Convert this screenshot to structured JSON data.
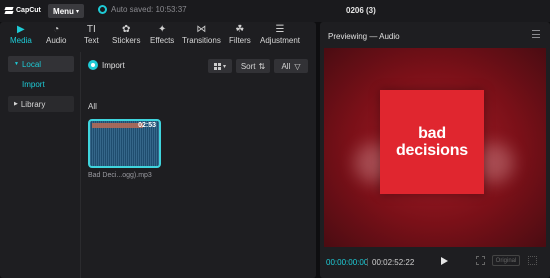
{
  "app": {
    "logo_text": "CapCut",
    "menu_label": "Menu",
    "autosave_text": "Auto saved: 10:53:37",
    "project_name": "0206 (3)"
  },
  "toolbar": {
    "tools": [
      {
        "label": "Media",
        "icon": "media-icon",
        "active": true
      },
      {
        "label": "Audio",
        "icon": "audio-icon",
        "active": false
      },
      {
        "label": "Text",
        "icon": "text-icon",
        "active": false
      },
      {
        "label": "Stickers",
        "icon": "stickers-icon",
        "active": false
      },
      {
        "label": "Effects",
        "icon": "effects-icon",
        "active": false
      },
      {
        "label": "Transitions",
        "icon": "transitions-icon",
        "active": false
      },
      {
        "label": "Filters",
        "icon": "filters-icon",
        "active": false
      },
      {
        "label": "Adjustment",
        "icon": "adjustment-icon",
        "active": false
      }
    ]
  },
  "sidebar": {
    "items": [
      {
        "label": "Local"
      },
      {
        "label": "Import"
      },
      {
        "label": "Library"
      }
    ]
  },
  "media": {
    "import_label": "Import",
    "sort_label": "Sort",
    "filter_label": "All",
    "section_label": "All",
    "items": [
      {
        "name": "Bad Deci...ogg).mp3",
        "duration": "02:53"
      }
    ]
  },
  "player": {
    "title": "Previewing — Audio",
    "cover_line1": "bad",
    "cover_line2": "decisions",
    "current_time": "00:00:00:00",
    "total_time": "00:02:52:22",
    "original_label": "Original"
  },
  "colors": {
    "accent": "#1ecbd6",
    "cover_red": "#e0262f",
    "stage_red": "#a81e28",
    "panel_bg": "#1e1e21"
  }
}
